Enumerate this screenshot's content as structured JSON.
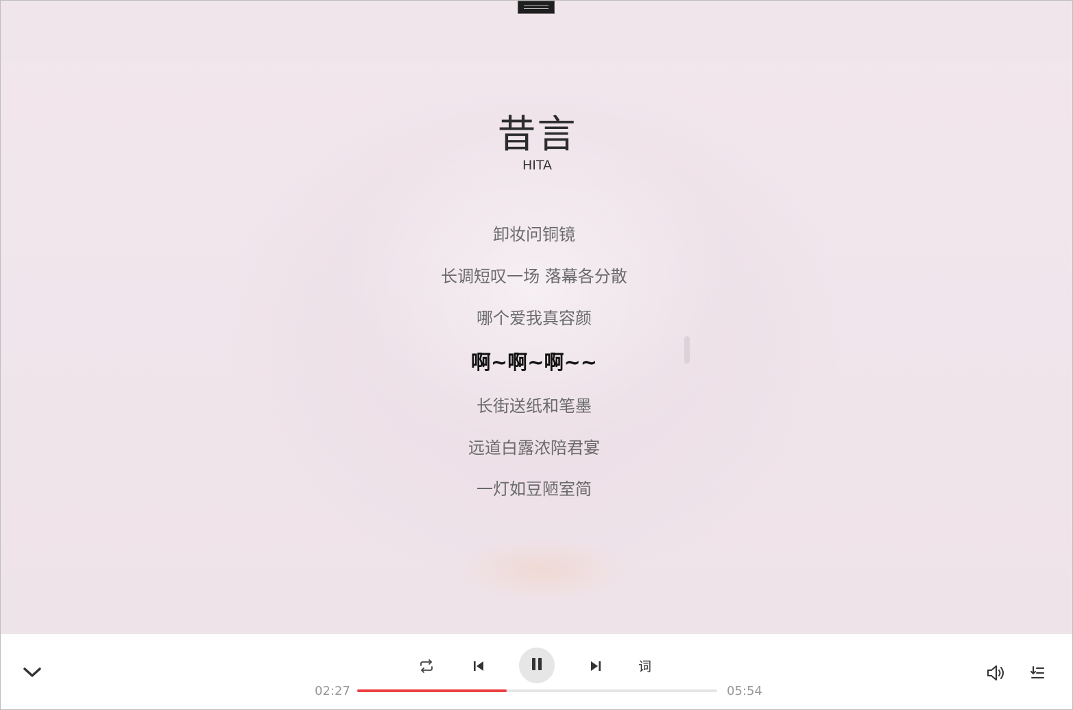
{
  "song": {
    "title": "昔言",
    "artist": "HITA"
  },
  "lyrics": {
    "lines": [
      "卸妆问铜镜",
      "长调短叹一场 落幕各分散",
      "哪个爱我真容颜",
      "啊~啊~啊~~",
      "长街送纸和笔墨",
      "远道白露浓陪君宴",
      "一灯如豆陋室简"
    ],
    "active_index": 3
  },
  "player": {
    "current_time": "02:27",
    "total_time": "05:54",
    "progress": 0.4153,
    "lyric_toggle_label": "词"
  },
  "icons": {
    "collapse": "chevron-down-icon",
    "loop": "repeat-icon",
    "prev": "skip-previous-icon",
    "pause": "pause-icon",
    "next": "skip-next-icon",
    "volume": "volume-icon",
    "playlist": "playlist-icon"
  },
  "colors": {
    "accent": "#ec4141",
    "background": "#f1e6ec"
  }
}
